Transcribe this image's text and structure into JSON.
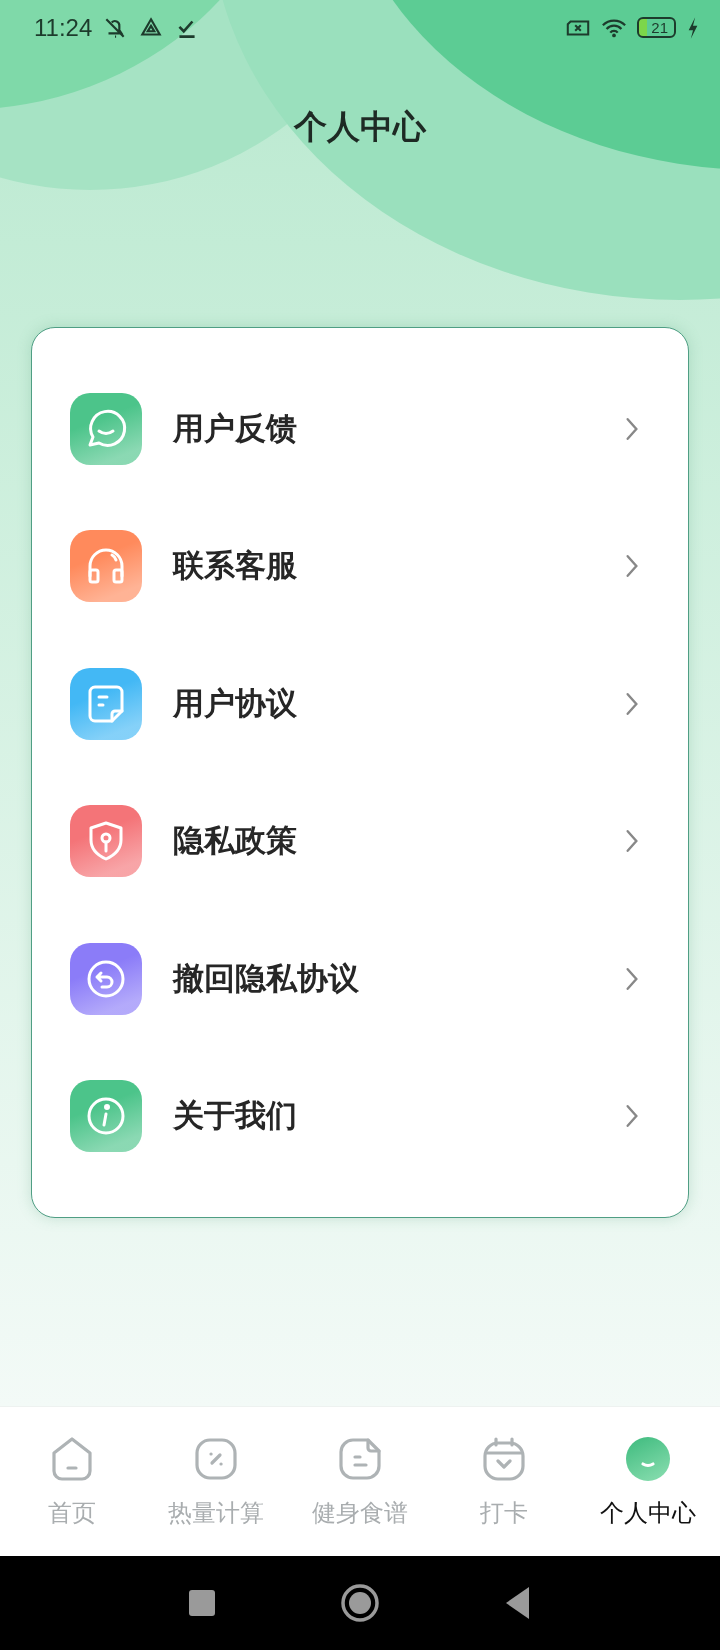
{
  "status_bar": {
    "time": "11:24",
    "battery": "21"
  },
  "title": "个人中心",
  "menu": [
    {
      "label": "用户反馈",
      "kind": "chat",
      "color": "#4cc48a"
    },
    {
      "label": "联系客服",
      "kind": "headset",
      "color": "#ff8a5c"
    },
    {
      "label": "用户协议",
      "kind": "note",
      "color": "#43b8f5"
    },
    {
      "label": "隐私政策",
      "kind": "shield",
      "color": "#f47478"
    },
    {
      "label": "撤回隐私协议",
      "kind": "undo",
      "color": "#8b7cf8"
    },
    {
      "label": "关于我们",
      "kind": "info",
      "color": "#4cc48a"
    }
  ],
  "tabs": [
    {
      "label": "首页",
      "kind": "home",
      "selected": false
    },
    {
      "label": "热量计算",
      "kind": "percent",
      "selected": false
    },
    {
      "label": "健身食谱",
      "kind": "doc",
      "selected": false
    },
    {
      "label": "打卡",
      "kind": "calendar",
      "selected": false
    },
    {
      "label": "个人中心",
      "kind": "smile",
      "selected": true
    }
  ]
}
